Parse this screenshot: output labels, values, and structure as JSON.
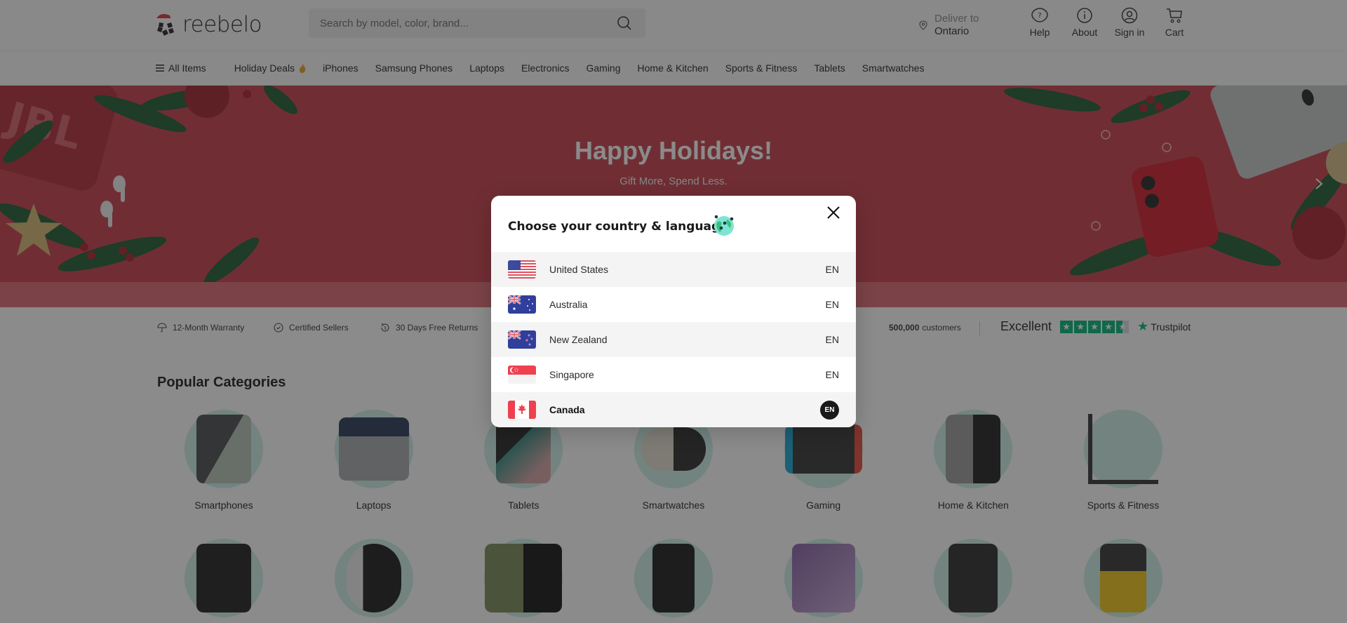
{
  "brand": {
    "name": "reebelo"
  },
  "header": {
    "search_placeholder": "Search by model, color, brand...",
    "deliver_label": "Deliver to",
    "deliver_location": "Ontario",
    "actions": [
      {
        "label": "Help",
        "icon": "help-icon"
      },
      {
        "label": "About",
        "icon": "info-icon"
      },
      {
        "label": "Sign in",
        "icon": "user-icon"
      },
      {
        "label": "Cart",
        "icon": "cart-icon"
      }
    ]
  },
  "nav": {
    "all_items": "All Items",
    "items": [
      "Holiday Deals",
      "iPhones",
      "Samsung Phones",
      "Laptops",
      "Electronics",
      "Gaming",
      "Home & Kitchen",
      "Sports & Fitness",
      "Tablets",
      "Smartwatches"
    ]
  },
  "hero": {
    "title": "Happy Holidays!",
    "subtitle": "Gift More, Spend Less."
  },
  "trust": {
    "warranty": "12-Month Warranty",
    "certified": "Certified Sellers",
    "returns": "30 Days Free Returns",
    "customers_count": "500,000",
    "customers_label": "customers",
    "rating_text": "Excellent",
    "rating_stars": 4.5,
    "trustpilot": "Trustpilot"
  },
  "categories": {
    "title": "Popular Categories",
    "row1": [
      "Smartphones",
      "Laptops",
      "Tablets",
      "Smartwatches",
      "Gaming",
      "Home & Kitchen",
      "Sports & Fitness"
    ],
    "row2": [
      "",
      "",
      "",
      "",
      "",
      "",
      ""
    ]
  },
  "modal": {
    "title": "Choose your country & language",
    "countries": [
      {
        "name": "United States",
        "lang": "EN",
        "selected": false
      },
      {
        "name": "Australia",
        "lang": "EN",
        "selected": false
      },
      {
        "name": "New Zealand",
        "lang": "EN",
        "selected": false
      },
      {
        "name": "Singapore",
        "lang": "EN",
        "selected": false
      },
      {
        "name": "Canada",
        "lang": "EN",
        "selected": true
      }
    ]
  },
  "colors": {
    "hero_bg": "#c93d4d",
    "trustpilot_green": "#00b67a",
    "category_circle": "#cdeeea"
  }
}
